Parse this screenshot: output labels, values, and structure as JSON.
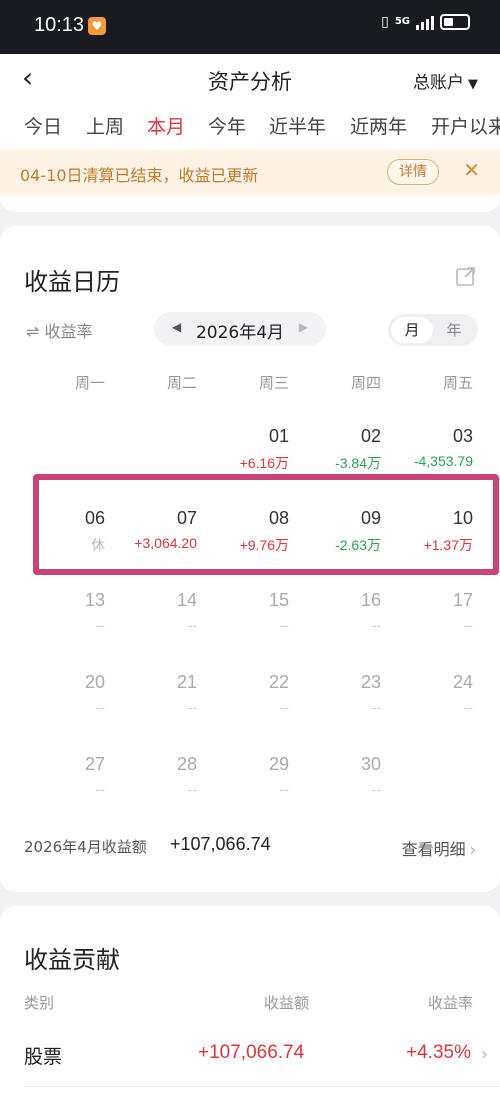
{
  "status_bar": {
    "time": "10:13",
    "network": "5G",
    "app_icon": "heart-icon"
  },
  "nav": {
    "back_icon": "chevron-left-icon",
    "title": "资产分析",
    "account": "总账户"
  },
  "tabs": [
    {
      "label": "今日",
      "active": false
    },
    {
      "label": "上周",
      "active": false
    },
    {
      "label": "本月",
      "active": true
    },
    {
      "label": "今年",
      "active": false
    },
    {
      "label": "近半年",
      "active": false
    },
    {
      "label": "近两年",
      "active": false
    },
    {
      "label": "开户以来",
      "active": false
    }
  ],
  "notice": {
    "text": "04-10日清算已结束，收益已更新",
    "button": "详情",
    "close": "✕"
  },
  "calendar": {
    "title": "收益日历",
    "rate_toggle": "⇌ 收益率",
    "month": "2026年4月",
    "mode": {
      "selected": "月",
      "other": "年"
    },
    "weekdays": [
      "周一",
      "周二",
      "周三",
      "周四",
      "周五"
    ],
    "rows": [
      [
        {
          "day": "",
          "value": "",
          "kind": "none"
        },
        {
          "day": "",
          "value": "",
          "kind": "none"
        },
        {
          "day": "01",
          "value": "+6.16万",
          "kind": "pos"
        },
        {
          "day": "02",
          "value": "-3.84万",
          "kind": "neg"
        },
        {
          "day": "03",
          "value": "-4,353.79",
          "kind": "neg"
        }
      ],
      [
        {
          "day": "06",
          "value": "休",
          "kind": "rest"
        },
        {
          "day": "07",
          "value": "+3,064.20",
          "kind": "pos"
        },
        {
          "day": "08",
          "value": "+9.76万",
          "kind": "pos"
        },
        {
          "day": "09",
          "value": "-2.63万",
          "kind": "neg"
        },
        {
          "day": "10",
          "value": "+1.37万",
          "kind": "pos"
        }
      ],
      [
        {
          "day": "13",
          "value": "--",
          "kind": "none"
        },
        {
          "day": "14",
          "value": "--",
          "kind": "none"
        },
        {
          "day": "15",
          "value": "--",
          "kind": "none"
        },
        {
          "day": "16",
          "value": "--",
          "kind": "none"
        },
        {
          "day": "17",
          "value": "--",
          "kind": "none"
        }
      ],
      [
        {
          "day": "20",
          "value": "--",
          "kind": "none"
        },
        {
          "day": "21",
          "value": "--",
          "kind": "none"
        },
        {
          "day": "22",
          "value": "--",
          "kind": "none"
        },
        {
          "day": "23",
          "value": "--",
          "kind": "none"
        },
        {
          "day": "24",
          "value": "--",
          "kind": "none"
        }
      ],
      [
        {
          "day": "27",
          "value": "--",
          "kind": "none"
        },
        {
          "day": "28",
          "value": "--",
          "kind": "none"
        },
        {
          "day": "29",
          "value": "--",
          "kind": "none"
        },
        {
          "day": "30",
          "value": "--",
          "kind": "none"
        },
        {
          "day": "",
          "value": "",
          "kind": "none"
        }
      ]
    ],
    "summary_label": "2026年4月收益额",
    "summary_value": "+107,066.74",
    "detail_link": "查看明细"
  },
  "contribution": {
    "title": "收益贡献",
    "headers": {
      "category": "类别",
      "amount": "收益额",
      "rate": "收益率"
    },
    "rows": [
      {
        "name": "股票",
        "amount": "+107,066.74",
        "rate": "+4.35%"
      }
    ]
  },
  "colors": {
    "up": "#d9363e",
    "down": "#2f9e55",
    "highlight": "#c94378",
    "notice_bg": "#fdf2e4"
  }
}
